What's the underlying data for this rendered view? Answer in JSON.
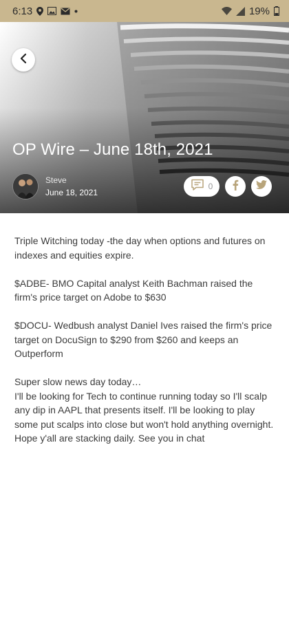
{
  "status_bar": {
    "time": "6:13",
    "battery": "19%",
    "icons_left": [
      "location-icon",
      "image-icon",
      "mail-icon",
      "dot-icon"
    ],
    "icons_right": [
      "wifi-icon",
      "signal-icon",
      "battery-icon"
    ]
  },
  "header": {
    "title": "OP Wire – June 18th, 2021",
    "author_name": "Steve",
    "date": "June 18, 2021",
    "comment_count": "0"
  },
  "colors": {
    "accent_gold": "#c9b78f",
    "icon_gold": "#b8a47a"
  },
  "article": {
    "paragraphs": [
      "Triple Witching today -the day when options and futures on indexes and equities expire.",
      "$ADBE- BMO Capital analyst Keith Bachman raised the firm's price target on Adobe to $630",
      "$DOCU- Wedbush analyst Daniel Ives raised the firm's price target on DocuSign to $290 from $260 and keeps an Outperform"
    ],
    "closing_lines": [
      "Super slow news day today…",
      "I'll be looking for Tech to continue running today so I'll scalp any dip in AAPL that presents itself. I'll be looking to play some put scalps into close but won't hold anything overnight.",
      "Hope y'all are stacking daily. See you in chat"
    ]
  }
}
